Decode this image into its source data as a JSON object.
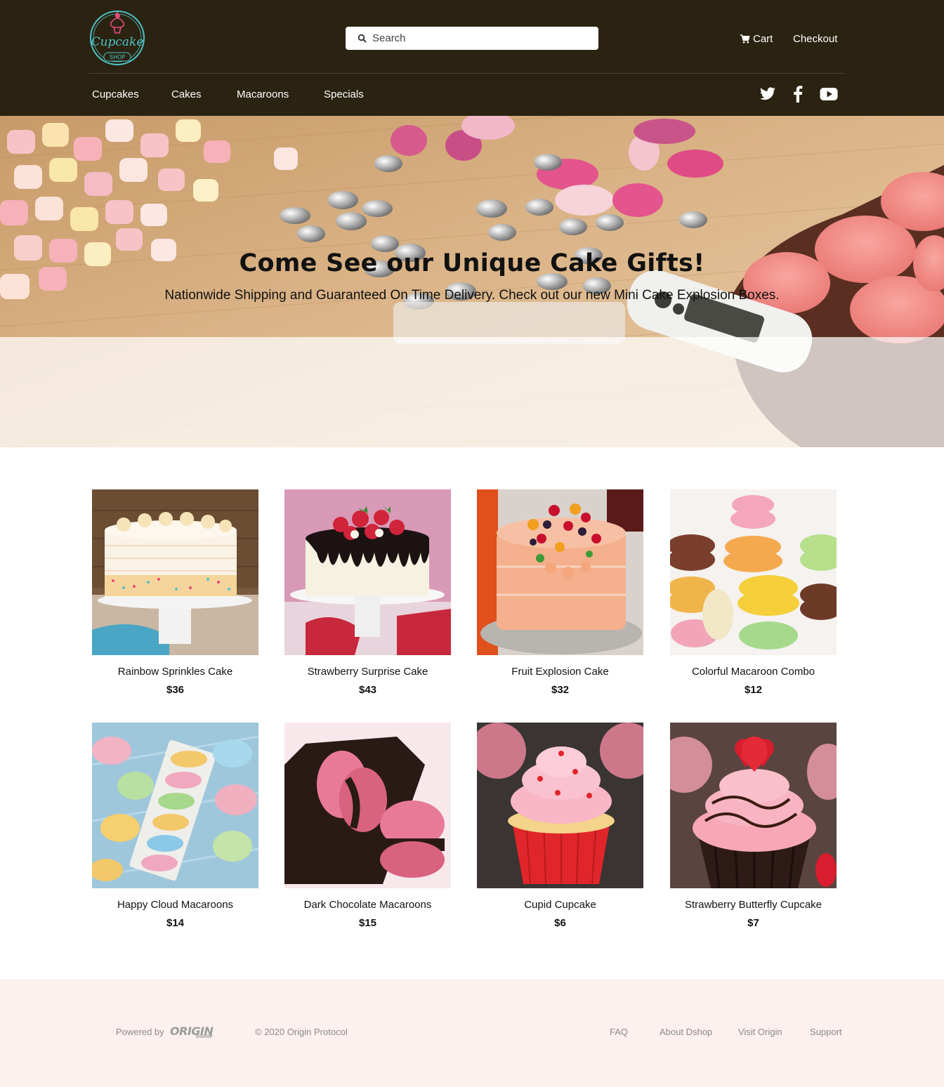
{
  "header": {
    "logo_script": "Cupcake",
    "logo_caption": "SHOP",
    "search_placeholder": "Search",
    "cart_label": "Cart",
    "checkout_label": "Checkout"
  },
  "nav": {
    "items": [
      "Cupcakes",
      "Cakes",
      "Macaroons",
      "Specials"
    ]
  },
  "social": [
    "twitter-icon",
    "facebook-icon",
    "youtube-icon"
  ],
  "hero": {
    "title": "Come See our Unique Cake Gifts!",
    "subtitle": "Nationwide Shipping and Guaranteed On Time Delivery. Check out our new Mini Cake Explosion Boxes."
  },
  "products": [
    {
      "name": "Rainbow Sprinkles Cake",
      "price": "$36"
    },
    {
      "name": "Strawberry Surprise Cake",
      "price": "$43"
    },
    {
      "name": "Fruit Explosion Cake",
      "price": "$32"
    },
    {
      "name": "Colorful Macaroon Combo",
      "price": "$12"
    },
    {
      "name": "Happy Cloud Macaroons",
      "price": "$14"
    },
    {
      "name": "Dark Chocolate Macaroons",
      "price": "$15"
    },
    {
      "name": "Cupid Cupcake",
      "price": "$6"
    },
    {
      "name": "Strawberry Butterfly Cupcake",
      "price": "$7"
    }
  ],
  "footer": {
    "powered_by": "Powered by",
    "brand": "ORIGIN",
    "brand_sub": "DSHOP",
    "copyright": "© 2020 Origin Protocol",
    "links": [
      "FAQ",
      "About Dshop",
      "Visit Origin",
      "Support"
    ]
  },
  "colors": {
    "header_bg": "#2a2311",
    "footer_bg": "#fcf1ef",
    "logo_teal": "#4ec3c8",
    "logo_pink": "#e94b7c"
  }
}
